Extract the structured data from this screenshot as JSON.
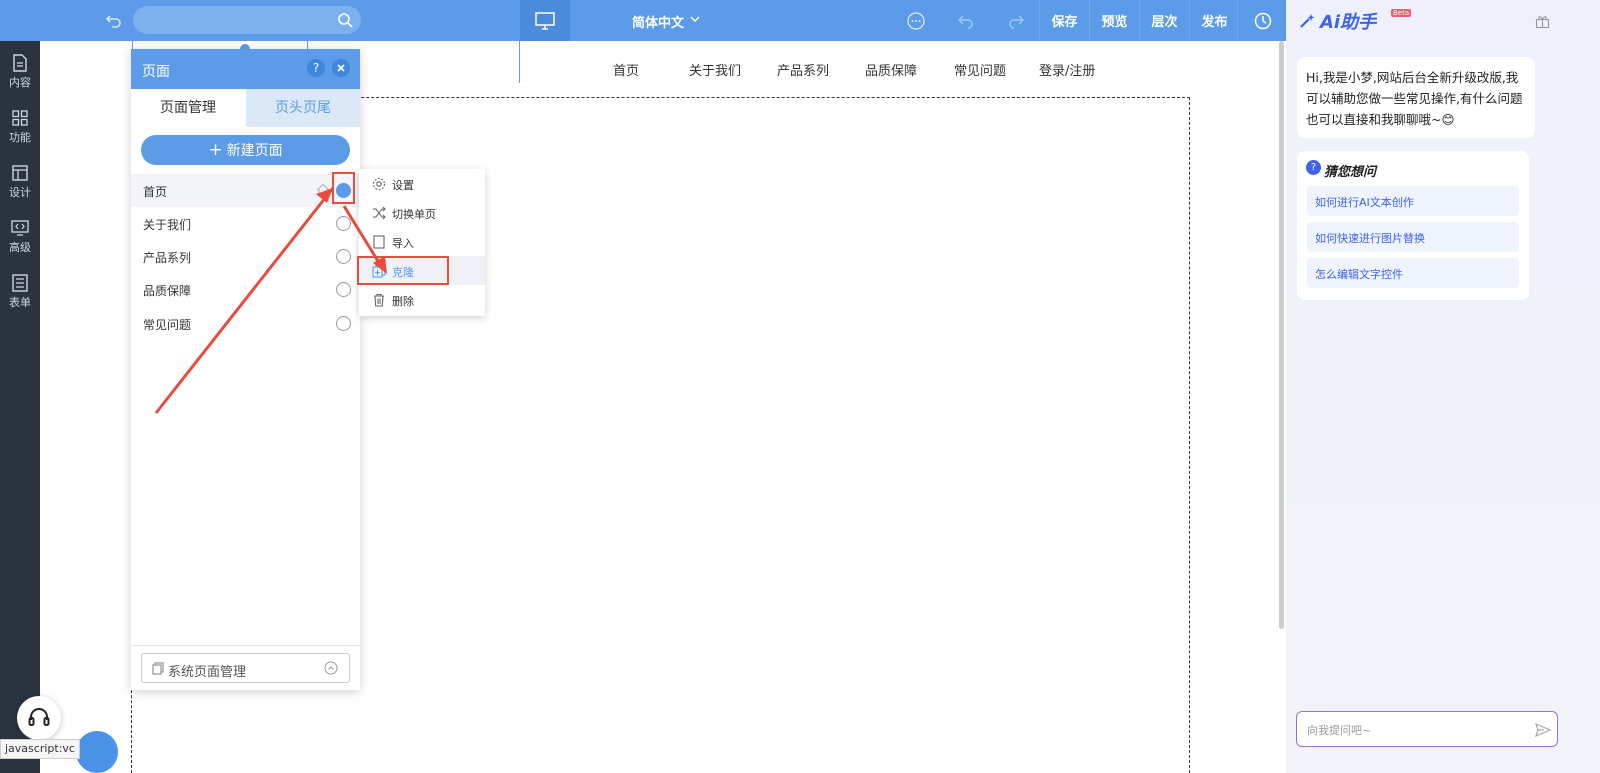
{
  "toolbar": {
    "language": "简体中文",
    "save": "保存",
    "preview": "预览",
    "layers": "层次",
    "publish": "发布"
  },
  "rail": [
    {
      "label": "内容",
      "icon": "document-icon"
    },
    {
      "label": "功能",
      "icon": "grid-icon"
    },
    {
      "label": "设计",
      "icon": "layout-icon"
    },
    {
      "label": "高级",
      "icon": "code-icon"
    },
    {
      "label": "表单",
      "icon": "form-icon"
    }
  ],
  "site_nav": [
    "首页",
    "关于我们",
    "产品系列",
    "品质保障",
    "常见问题",
    "登录/注册"
  ],
  "panel": {
    "title": "页面",
    "help": "?",
    "tab_pages": "页面管理",
    "tab_header_footer": "页头页尾",
    "new_page": "新建页面",
    "pages": [
      "首页",
      "关于我们",
      "产品系列",
      "品质保障",
      "常见问题"
    ],
    "system_pages": "系统页面管理"
  },
  "context_menu": [
    "设置",
    "切换单页",
    "导入",
    "克隆",
    "删除"
  ],
  "ai": {
    "title": "Ai助手",
    "beta": "Beta",
    "greeting": "Hi,我是小梦,网站后台全新升级改版,我可以辅助您做一些常见操作,有什么问题也可以直接和我聊聊哦~😊",
    "guess_title": "猜您想问",
    "suggestions": [
      "如何进行AI文本创作",
      "如何快速进行图片替换",
      "怎么编辑文字控件"
    ],
    "input_placeholder": "向我提问吧~"
  },
  "status_url": "javascript:vc",
  "colors": {
    "primary": "#5b9be8",
    "rail": "#2b3341",
    "annotation": "#e74c3c",
    "ai_accent": "#3f63e8"
  }
}
